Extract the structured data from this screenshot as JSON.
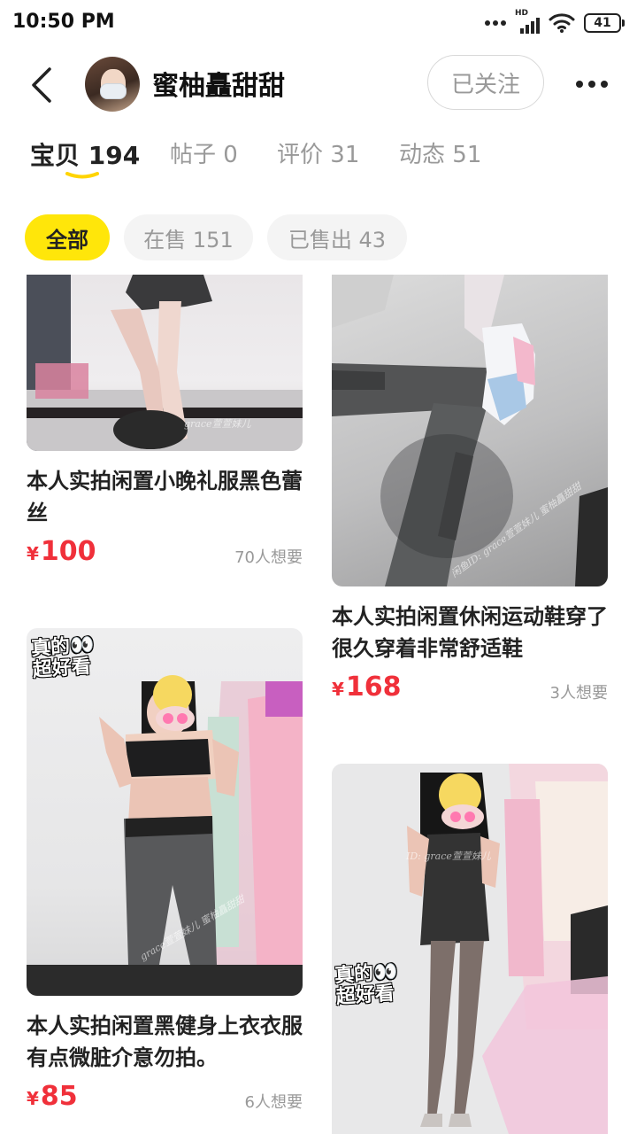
{
  "status_bar": {
    "time": "10:50 PM",
    "network_label": "HD",
    "battery": "41"
  },
  "header": {
    "username": "蜜柚矗甜甜",
    "follow_label": "已关注"
  },
  "tabs": [
    {
      "label": "宝贝",
      "count": "194"
    },
    {
      "label": "帖子",
      "count": "0"
    },
    {
      "label": "评价",
      "count": "31"
    },
    {
      "label": "动态",
      "count": "51"
    }
  ],
  "filters": [
    {
      "label": "全部"
    },
    {
      "label": "在售 151"
    },
    {
      "label": "已售出 43"
    }
  ],
  "items": [
    {
      "title": "本人实拍闲置小晚礼服黑色蕾丝",
      "currency": "¥",
      "price": "100",
      "wants": "70人想要",
      "watermark": "grace萱萱妹儿"
    },
    {
      "title": "本人实拍闲置休闲运动鞋穿了很久穿着非常舒适鞋",
      "currency": "¥",
      "price": "168",
      "wants": "3人想要",
      "watermark": "闲鱼ID: grace萱萱妹儿 蜜柚矗甜甜"
    },
    {
      "title": "本人实拍闲置黑健身上衣衣服有点微脏介意勿拍。",
      "currency": "¥",
      "price": "85",
      "wants": "6人想要",
      "sticker_line1": "真的",
      "sticker_line2": "超好看",
      "watermark": "grace萱萱妹儿 蜜柚矗甜甜"
    },
    {
      "title": "",
      "currency": "",
      "price": "",
      "wants": "",
      "sticker_line1": "真的",
      "sticker_line2": "超好看",
      "watermark": "ID: grace萱萱妹儿"
    }
  ],
  "colors": {
    "accent_yellow": "#ffe60a",
    "price_red": "#f0303a",
    "muted_text": "#999999"
  },
  "icons": [
    "back-arrow-icon",
    "more-icon",
    "signal-icon",
    "wifi-icon",
    "battery-icon"
  ]
}
